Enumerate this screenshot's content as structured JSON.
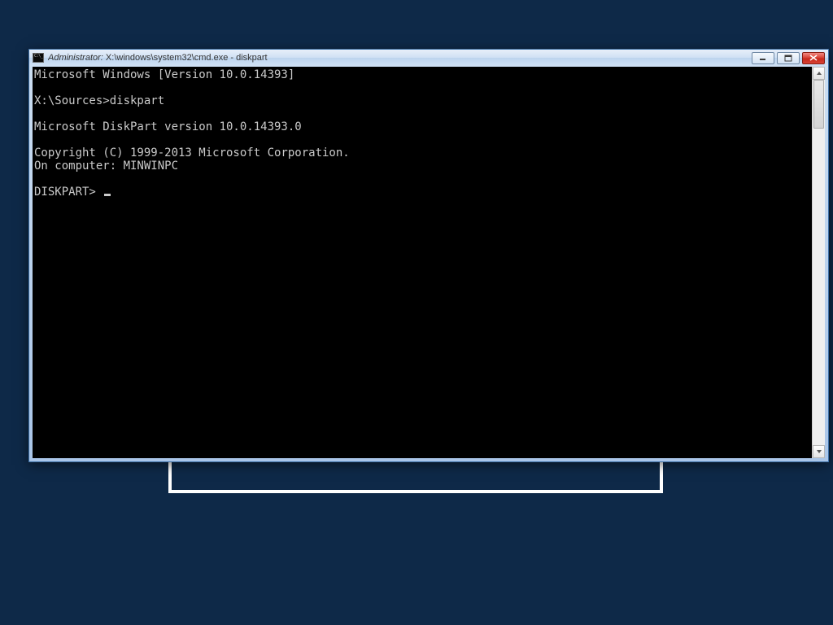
{
  "window": {
    "title_prefix": "Administrator: ",
    "title_path": "X:\\windows\\system32\\cmd.exe - diskpart"
  },
  "terminal": {
    "lines": [
      "Microsoft Windows [Version 10.0.14393]",
      "",
      "X:\\Sources>diskpart",
      "",
      "Microsoft DiskPart version 10.0.14393.0",
      "",
      "Copyright (C) 1999-2013 Microsoft Corporation.",
      "On computer: MINWINPC",
      ""
    ],
    "prompt": "DISKPART>"
  }
}
